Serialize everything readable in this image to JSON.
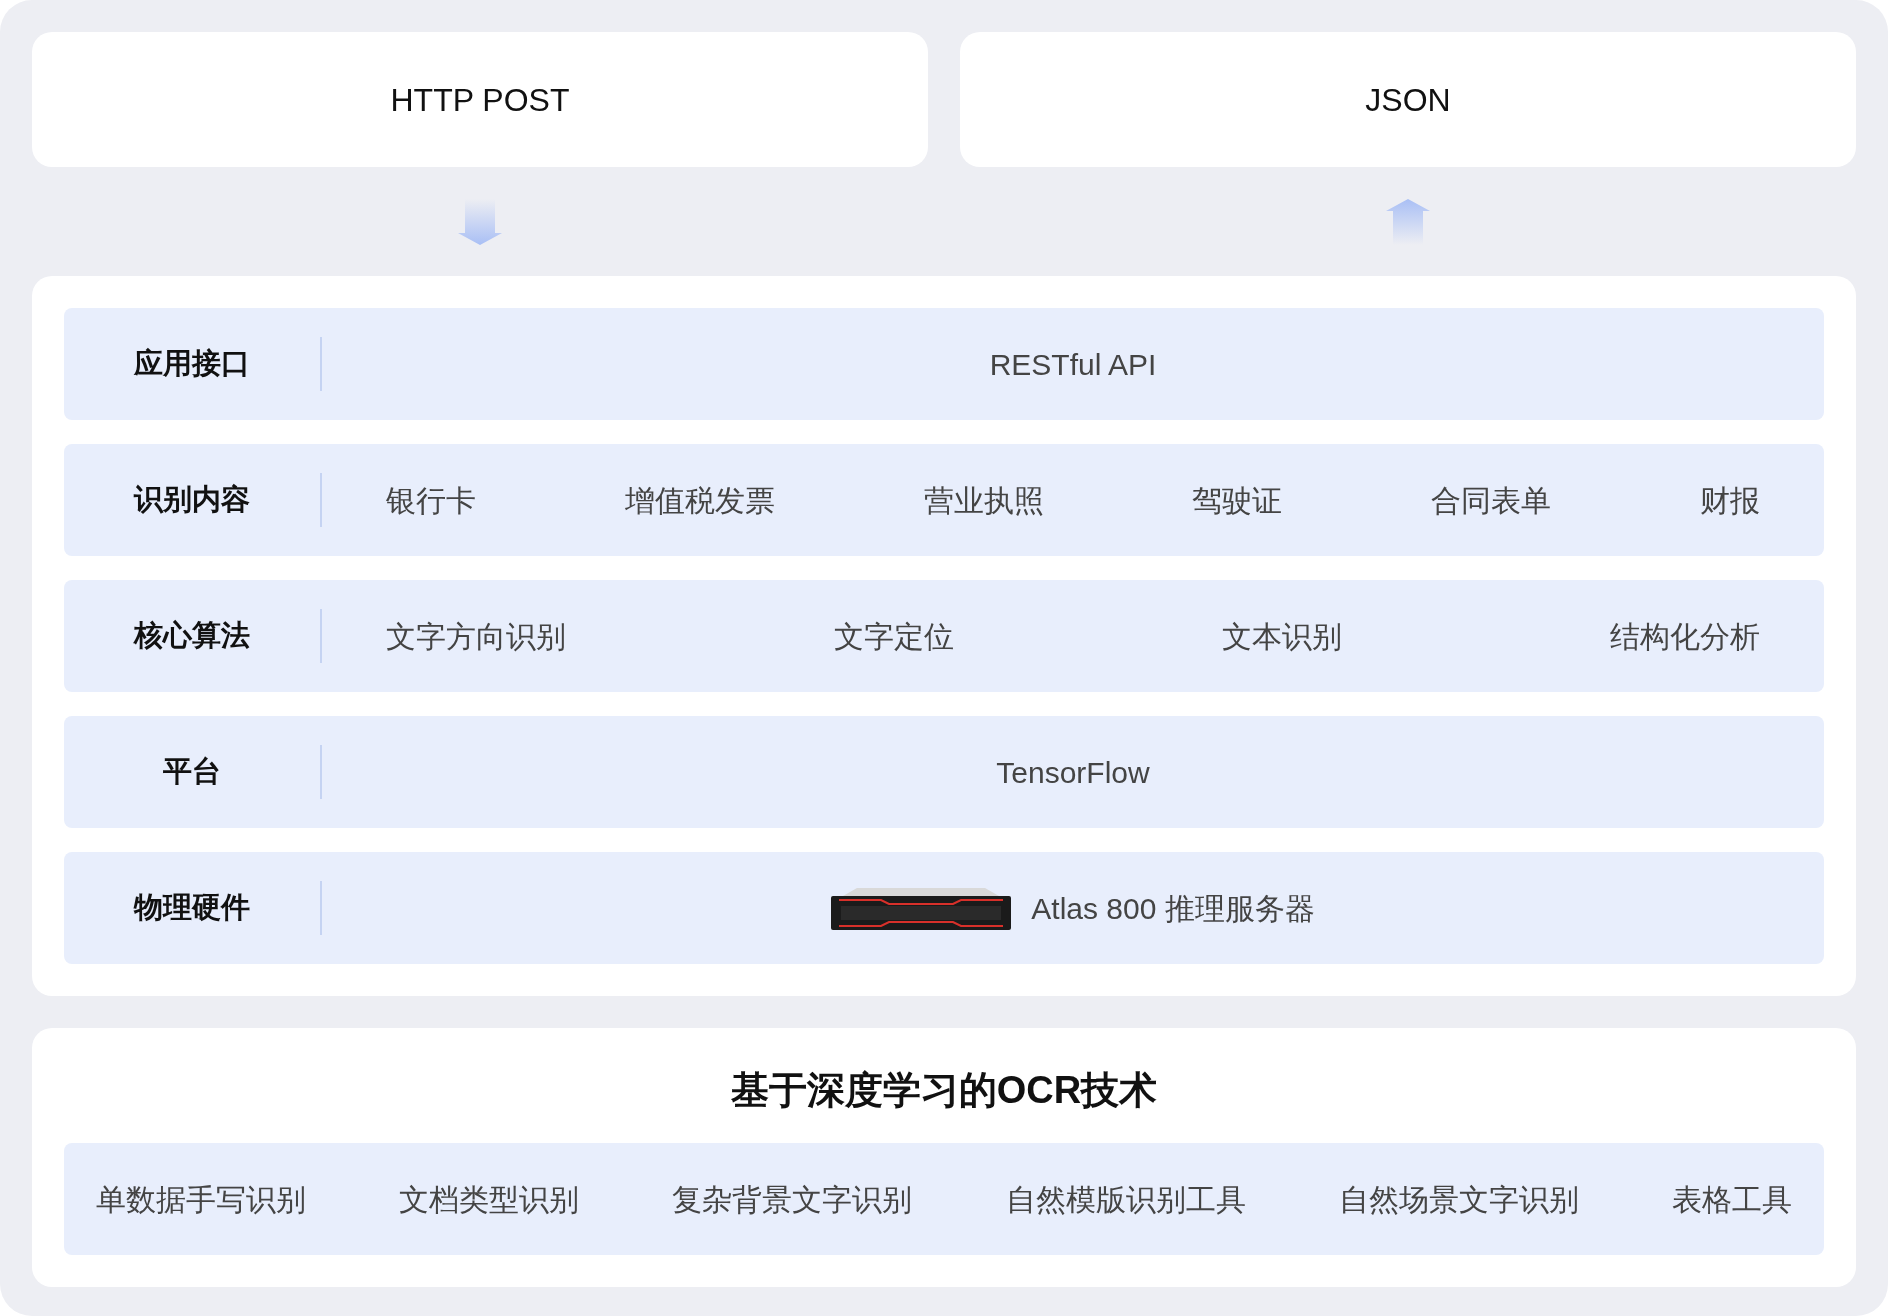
{
  "top_boxes": [
    {
      "label": "HTTP POST",
      "kind": "down"
    },
    {
      "label": "JSON",
      "kind": "up"
    }
  ],
  "layers": [
    {
      "label": "应用接口",
      "kind": "single",
      "items": [
        "RESTful API"
      ]
    },
    {
      "label": "识别内容",
      "kind": "list",
      "items": [
        "银行卡",
        "增值税发票",
        "营业执照",
        "驾驶证",
        "合同表单",
        "财报"
      ]
    },
    {
      "label": "核心算法",
      "kind": "list",
      "items": [
        "文字方向识别",
        "文字定位",
        "文本识别",
        "结构化分析"
      ]
    },
    {
      "label": "平台",
      "kind": "single",
      "items": [
        "TensorFlow"
      ]
    },
    {
      "label": "物理硬件",
      "kind": "hardware",
      "items": [
        "Atlas 800 推理服务器"
      ]
    }
  ],
  "technology": {
    "title": "基于深度学习的OCR技术",
    "items": [
      "单数据手写识别",
      "文档类型识别",
      "复杂背景文字识别",
      "自然模版识别工具",
      "自然场景文字识别",
      "表格工具"
    ]
  }
}
